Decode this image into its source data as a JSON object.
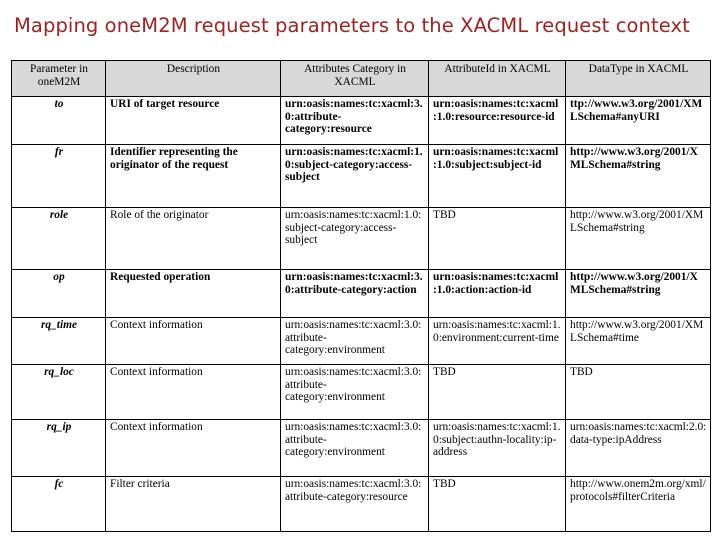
{
  "slide": {
    "title": "Mapping oneM2M request parameters to the XACML request context",
    "title_color": "#9c2321"
  },
  "table": {
    "headers": [
      "Parameter in oneM2M",
      "Description",
      "Attributes Category in XACML",
      "AttributeId in XACML",
      "DataType in XACML"
    ],
    "rows": [
      {
        "parameter": "to",
        "description": "URI of target resource",
        "category": "urn:oasis:names:tc:xacml:3.0:attribute-category:resource",
        "attribute_id": "urn:oasis:names:tc:xacml:1.0:resource:resource-id",
        "data_type": "ttp://www.w3.org/2001/XMLSchema#anyURI",
        "bold": true
      },
      {
        "parameter": "fr",
        "description": "Identifier representing the originator of the request",
        "category": "urn:oasis:names:tc:xacml:1.0:subject-category:access-subject",
        "attribute_id": "urn:oasis:names:tc:xacml:1.0:subject:subject-id",
        "data_type": "http://www.w3.org/2001/XMLSchema#string",
        "bold": true
      },
      {
        "parameter": "role",
        "description": "Role of the originator",
        "category": "urn:oasis:names:tc:xacml:1.0:subject-category:access-subject",
        "attribute_id": "TBD",
        "data_type": "http://www.w3.org/2001/XMLSchema#string",
        "bold": false
      },
      {
        "parameter": "op",
        "description": "Requested operation",
        "category": "urn:oasis:names:tc:xacml:3.0:attribute-category:action",
        "attribute_id": "urn:oasis:names:tc:xacml:1.0:action:action-id",
        "data_type": "http://www.w3.org/2001/XMLSchema#string",
        "bold": true
      },
      {
        "parameter": "rq_time",
        "description": "Context information",
        "category": "urn:oasis:names:tc:xacml:3.0:attribute-category:environment",
        "attribute_id": "urn:oasis:names:tc:xacml:1.0:environment:current-time",
        "data_type": "http://www.w3.org/2001/XMLSchema#time",
        "bold": false
      },
      {
        "parameter": "rq_loc",
        "description": "Context information",
        "category": "urn:oasis:names:tc:xacml:3.0:attribute-category:environment",
        "attribute_id": "TBD",
        "data_type": "TBD",
        "bold": false
      },
      {
        "parameter": "rq_ip",
        "description": "Context information",
        "category": "urn:oasis:names:tc:xacml:3.0:attribute-category:environment",
        "attribute_id": "urn:oasis:names:tc:xacml:1.0:subject:authn-locality:ip-address",
        "data_type": "urn:oasis:names:tc:xacml:2.0:data-type:ipAddress",
        "bold": false
      },
      {
        "parameter": "fc",
        "description": "Filter criteria",
        "category": "urn:oasis:names:tc:xacml:3.0:attribute-category:resource",
        "attribute_id": "TBD",
        "data_type": "http://www.onem2m.org/xml/protocols#filterCriteria",
        "bold": false
      }
    ]
  }
}
